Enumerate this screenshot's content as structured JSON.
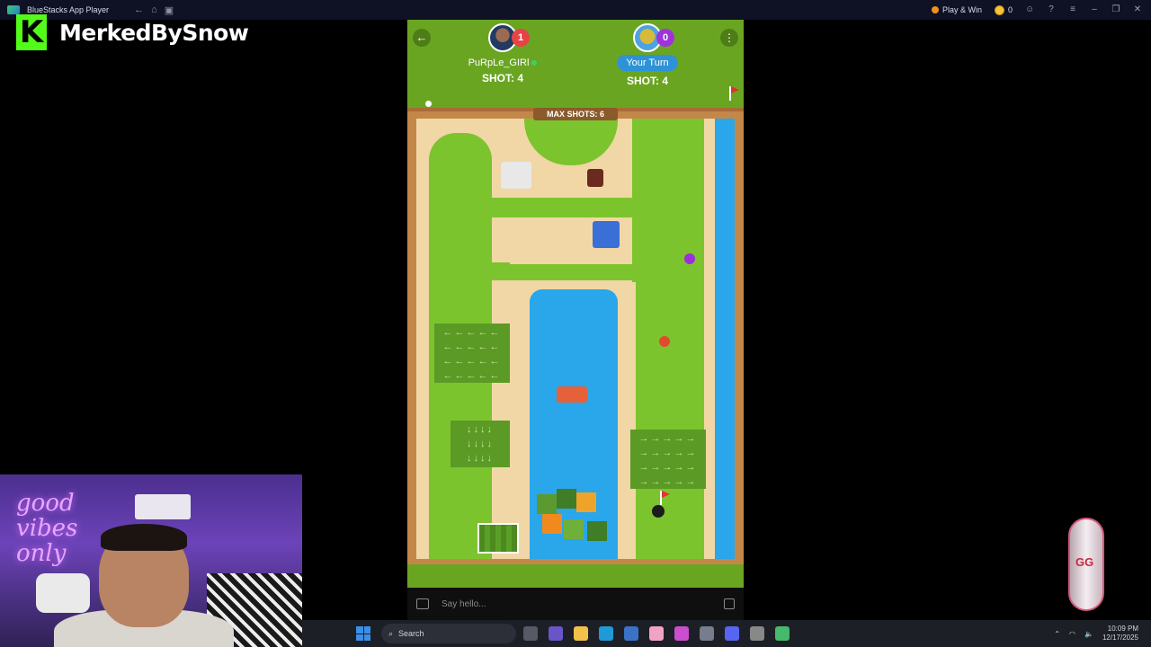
{
  "window": {
    "title": "BlueStacks App Player",
    "play_win": "Play & Win",
    "coins": "0"
  },
  "overlay": {
    "brand_letter": "K",
    "streamer": "MerkedBySnow",
    "neon_sign": "good vibes only",
    "side_logo": "GG"
  },
  "game": {
    "max_shots": "MAX SHOTS: 6",
    "players": [
      {
        "name": "PuRpLe_GIRl",
        "score": "1",
        "shot": "SHOT: 4",
        "online": true
      },
      {
        "name": "Your Turn",
        "score": "0",
        "shot": "SHOT: 4"
      }
    ],
    "chat_placeholder": "Say hello...",
    "balls": [
      {
        "color": "#9b2fdb"
      },
      {
        "color": "#e14a2a"
      }
    ]
  },
  "taskbar": {
    "search_placeholder": "Search",
    "time": "10:09 PM",
    "date": "12/17/2025"
  }
}
